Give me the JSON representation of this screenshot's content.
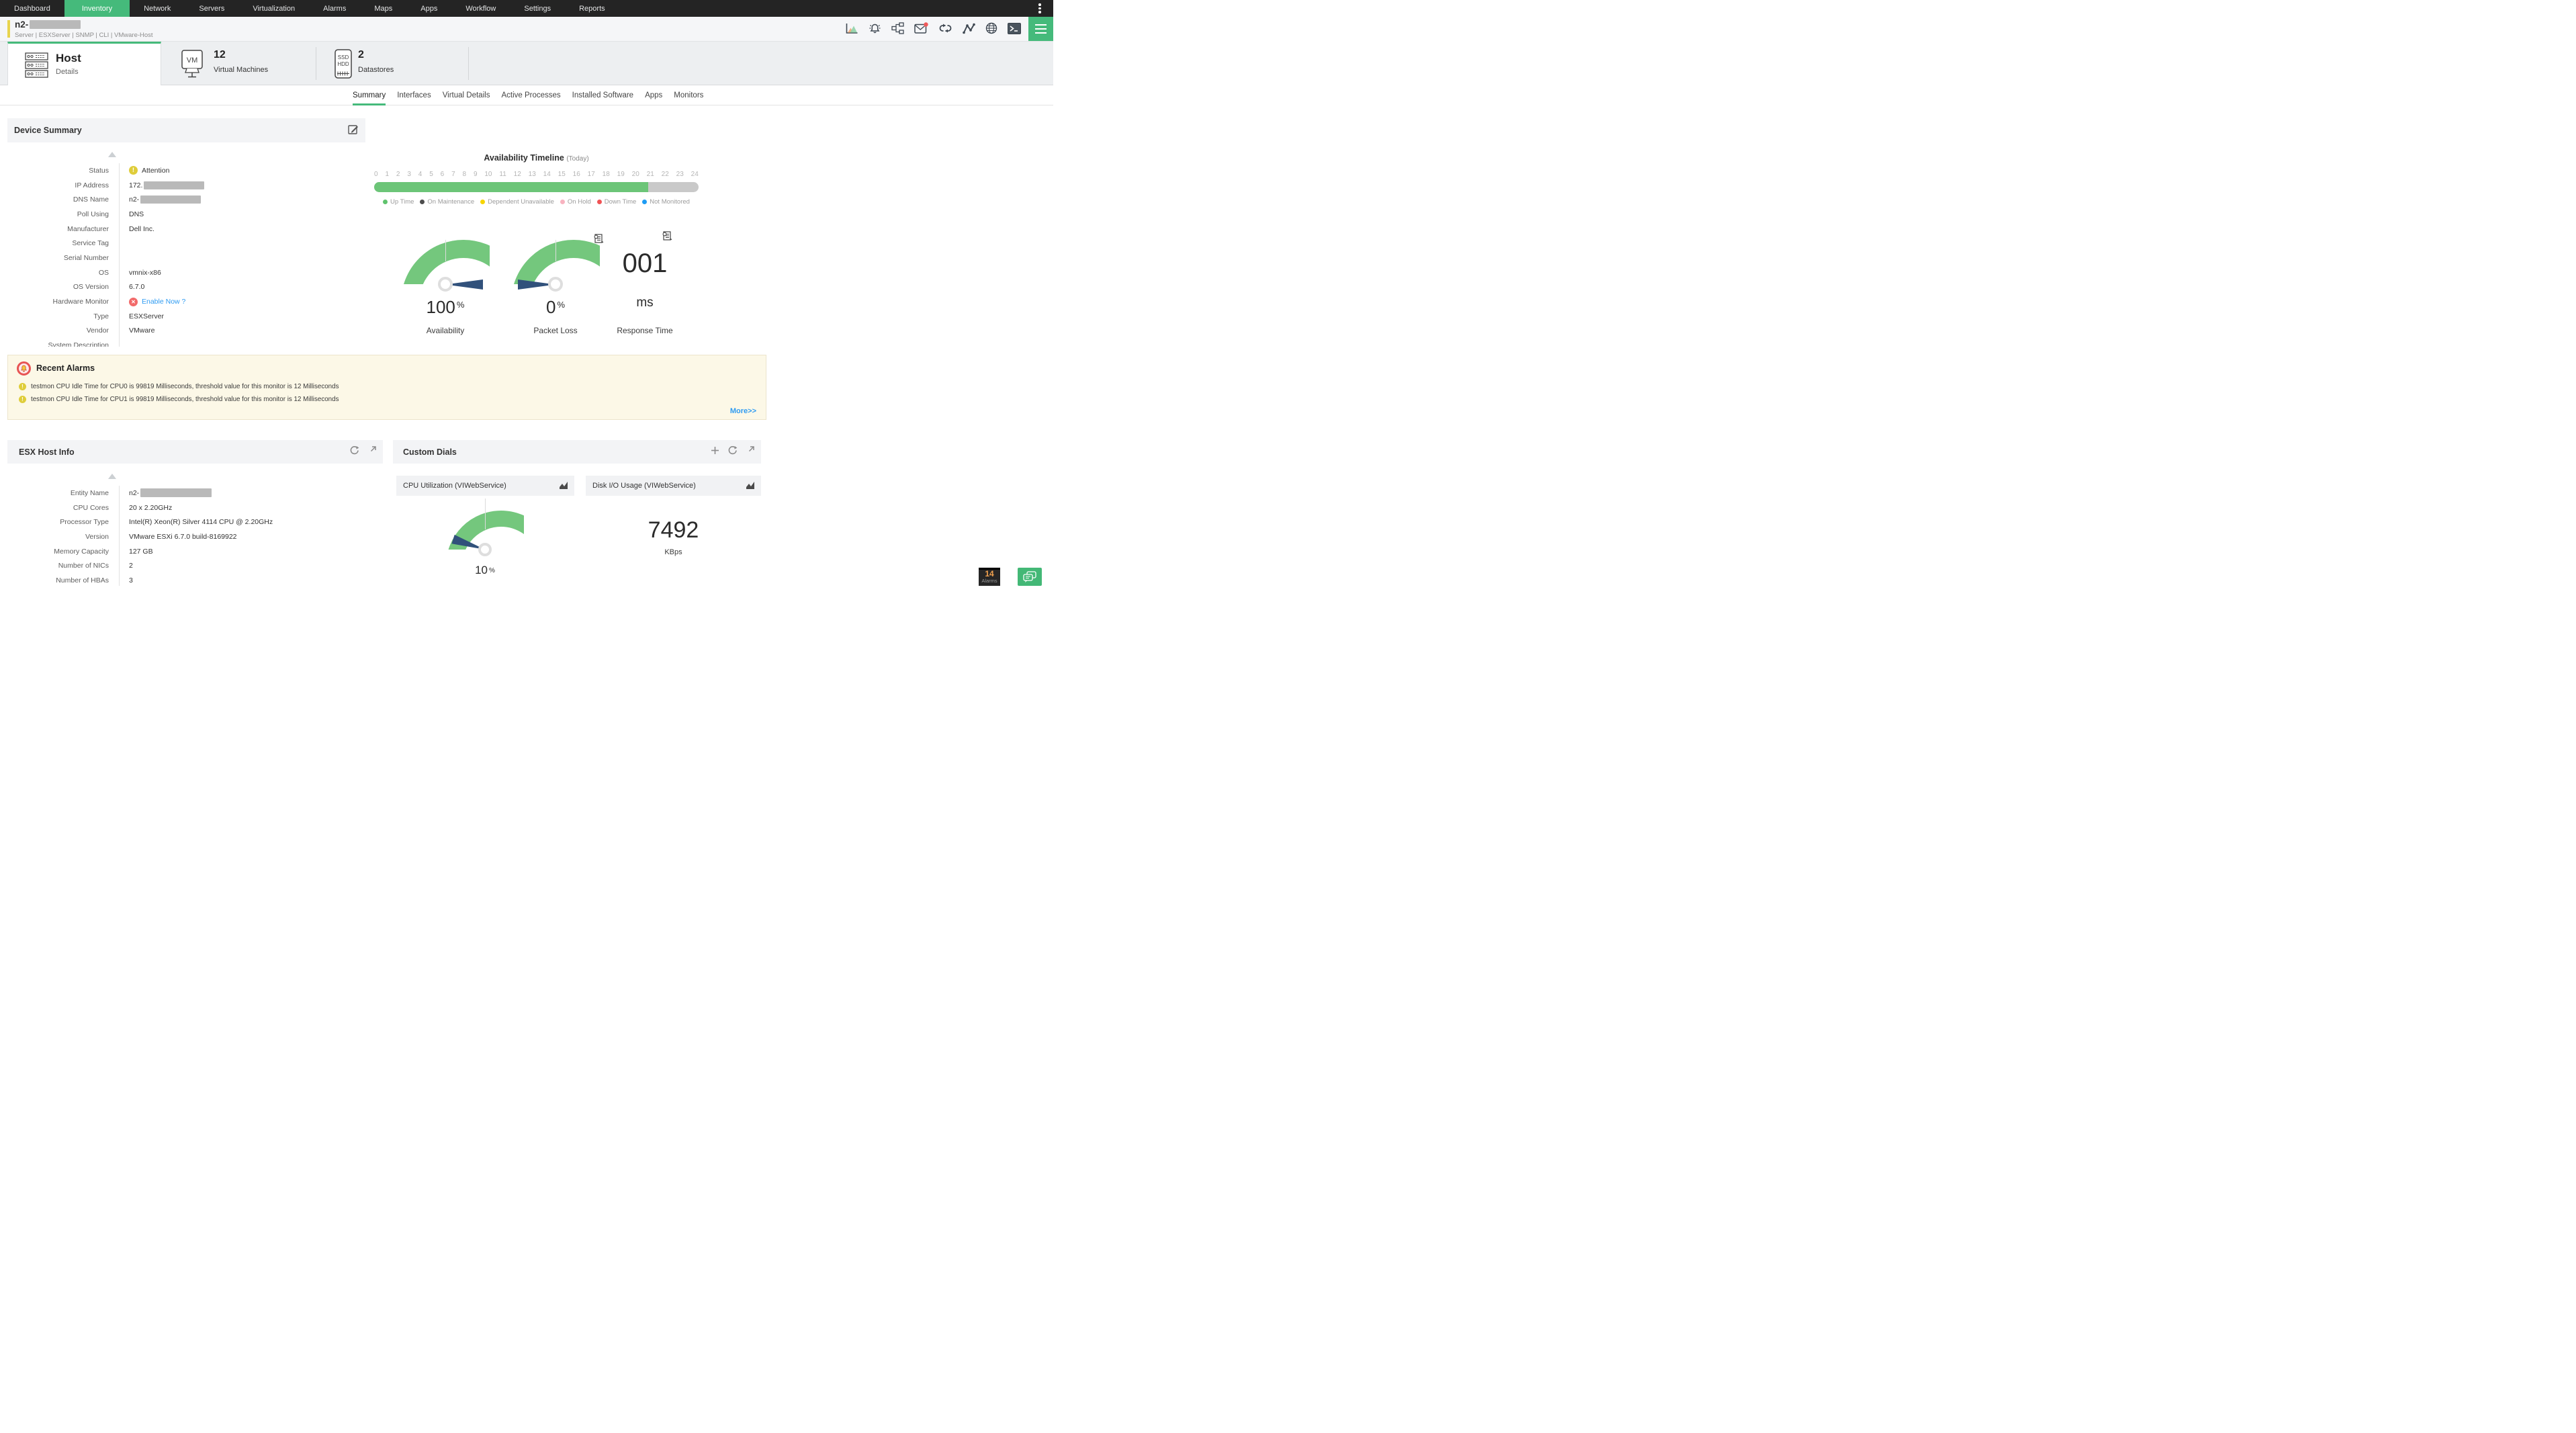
{
  "nav": {
    "items": [
      "Dashboard",
      "Inventory",
      "Network",
      "Servers",
      "Virtualization",
      "Alarms",
      "Maps",
      "Apps",
      "Workflow",
      "Settings",
      "Reports"
    ],
    "active": "Inventory"
  },
  "header": {
    "device_name": "n2-",
    "device_meta": "Server | ESXServer | SNMP | CLI | VMware-Host",
    "toolbar_icons": [
      "performance-chart",
      "alarm-bell",
      "workflow-diagram",
      "mail",
      "sync-loop",
      "line-graph",
      "globe",
      "terminal",
      "menu"
    ]
  },
  "entity_tabs": {
    "host": {
      "title": "Host",
      "subtitle": "Details"
    },
    "vms": {
      "count": "12",
      "label": "Virtual Machines",
      "icon_label": "VM"
    },
    "datastores": {
      "count": "2",
      "label": "Datastores",
      "icon_line1": "SSD",
      "icon_line2": "HDD"
    }
  },
  "subtabs": [
    "Summary",
    "Interfaces",
    "Virtual Details",
    "Active Processes",
    "Installed Software",
    "Apps",
    "Monitors"
  ],
  "active_subtab": "Summary",
  "device_summary": {
    "title": "Device Summary",
    "fields": [
      {
        "label": "Status",
        "value": "Attention"
      },
      {
        "label": "IP Address",
        "value": "172."
      },
      {
        "label": "DNS Name",
        "value": "n2-"
      },
      {
        "label": "Poll Using",
        "value": "DNS"
      },
      {
        "label": "Manufacturer",
        "value": "Dell Inc."
      },
      {
        "label": "Service Tag",
        "value": ""
      },
      {
        "label": "Serial Number",
        "value": ""
      },
      {
        "label": "OS",
        "value": "vmnix-x86"
      },
      {
        "label": "OS Version",
        "value": "6.7.0"
      },
      {
        "label": "Hardware Monitor",
        "value": "Enable Now ?"
      },
      {
        "label": "Type",
        "value": "ESXServer"
      },
      {
        "label": "Vendor",
        "value": "VMware"
      },
      {
        "label": "System Description",
        "value": ""
      }
    ]
  },
  "timeline": {
    "title": "Availability Timeline",
    "subtitle": "(Today)",
    "hours": [
      "0",
      "1",
      "2",
      "3",
      "4",
      "5",
      "6",
      "7",
      "8",
      "9",
      "10",
      "11",
      "12",
      "13",
      "14",
      "15",
      "16",
      "17",
      "18",
      "19",
      "20",
      "21",
      "22",
      "23",
      "24"
    ],
    "up_pct": 84.5,
    "legend": [
      {
        "label": "Up Time",
        "color": "#5fc36d"
      },
      {
        "label": "On Maintenance",
        "color": "#4d4d4d"
      },
      {
        "label": "Dependent Unavailable",
        "color": "#f7d500"
      },
      {
        "label": "On Hold",
        "color": "#f8b3c0"
      },
      {
        "label": "Down Time",
        "color": "#f05355"
      },
      {
        "label": "Not Monitored",
        "color": "#1e9cf4"
      }
    ]
  },
  "gauges": {
    "availability": {
      "label": "Availability",
      "value": "100",
      "unit": "%",
      "pct": 100
    },
    "packet_loss": {
      "label": "Packet Loss",
      "value": "0",
      "unit": "%",
      "pct": 0
    },
    "response_time": {
      "label": "Response Time",
      "value": "001",
      "unit": "ms"
    }
  },
  "recent_alarms": {
    "title": "Recent Alarms",
    "items": [
      "testmon CPU Idle Time for CPU0 is 99819 Milliseconds, threshold value for this monitor is 12 Milliseconds",
      "testmon CPU Idle Time for CPU1 is 99819 Milliseconds, threshold value for this monitor is 12 Milliseconds"
    ],
    "more_label": "More>>"
  },
  "esx_host_info": {
    "title": "ESX Host Info",
    "fields": [
      {
        "label": "Entity Name",
        "value": "n2-"
      },
      {
        "label": "CPU Cores",
        "value": "20 x 2.20GHz"
      },
      {
        "label": "Processor Type",
        "value": "Intel(R) Xeon(R) Silver 4114 CPU @ 2.20GHz"
      },
      {
        "label": "Version",
        "value": "VMware ESXi 6.7.0 build-8169922"
      },
      {
        "label": "Memory Capacity",
        "value": "127 GB"
      },
      {
        "label": "Number of NICs",
        "value": "2"
      },
      {
        "label": "Number of HBAs",
        "value": "3"
      }
    ]
  },
  "custom_dials": {
    "title": "Custom Dials",
    "dials": [
      {
        "title": "CPU Utilization (VIWebService)",
        "value": "10",
        "unit": "%",
        "pct": 10,
        "type": "gauge"
      },
      {
        "title": "Disk I/O Usage (VIWebService)",
        "value": "7492",
        "unit": "KBps",
        "type": "number"
      }
    ]
  },
  "footer": {
    "alarm_count": "14",
    "alarm_label": "Alarms"
  },
  "colors": {
    "accent_green": "#45ba7b",
    "nav_bg": "#242424",
    "attention_yellow": "#dfcd3a",
    "error_red": "#f26a6a",
    "link_blue": "#2e9bf2",
    "gauge_green": "#74c77d",
    "needle_blue": "#31517b",
    "alarm_panel_bg": "#fcf8e7",
    "badge_orange": "#f0a14f"
  },
  "chart_data": [
    {
      "type": "bar",
      "title": "Availability Timeline (Today)",
      "x_ticks": [
        0,
        1,
        2,
        3,
        4,
        5,
        6,
        7,
        8,
        9,
        10,
        11,
        12,
        13,
        14,
        15,
        16,
        17,
        18,
        19,
        20,
        21,
        22,
        23,
        24
      ],
      "series": [
        {
          "name": "Up Time",
          "from_hour": 0,
          "to_hour": 20.3
        },
        {
          "name": "Not Monitored (remaining)",
          "from_hour": 20.3,
          "to_hour": 24
        }
      ],
      "legend_position": "bottom"
    },
    {
      "type": "gauge",
      "title": "Availability",
      "value": 100,
      "unit": "%",
      "range": [
        0,
        100
      ]
    },
    {
      "type": "gauge",
      "title": "Packet Loss",
      "value": 0,
      "unit": "%",
      "range": [
        0,
        100
      ]
    },
    {
      "type": "number",
      "title": "Response Time",
      "value": 1,
      "display": "001",
      "unit": "ms"
    },
    {
      "type": "gauge",
      "title": "CPU Utilization (VIWebService)",
      "value": 10,
      "unit": "%",
      "range": [
        0,
        100
      ]
    },
    {
      "type": "number",
      "title": "Disk I/O Usage (VIWebService)",
      "value": 7492,
      "unit": "KBps"
    }
  ]
}
